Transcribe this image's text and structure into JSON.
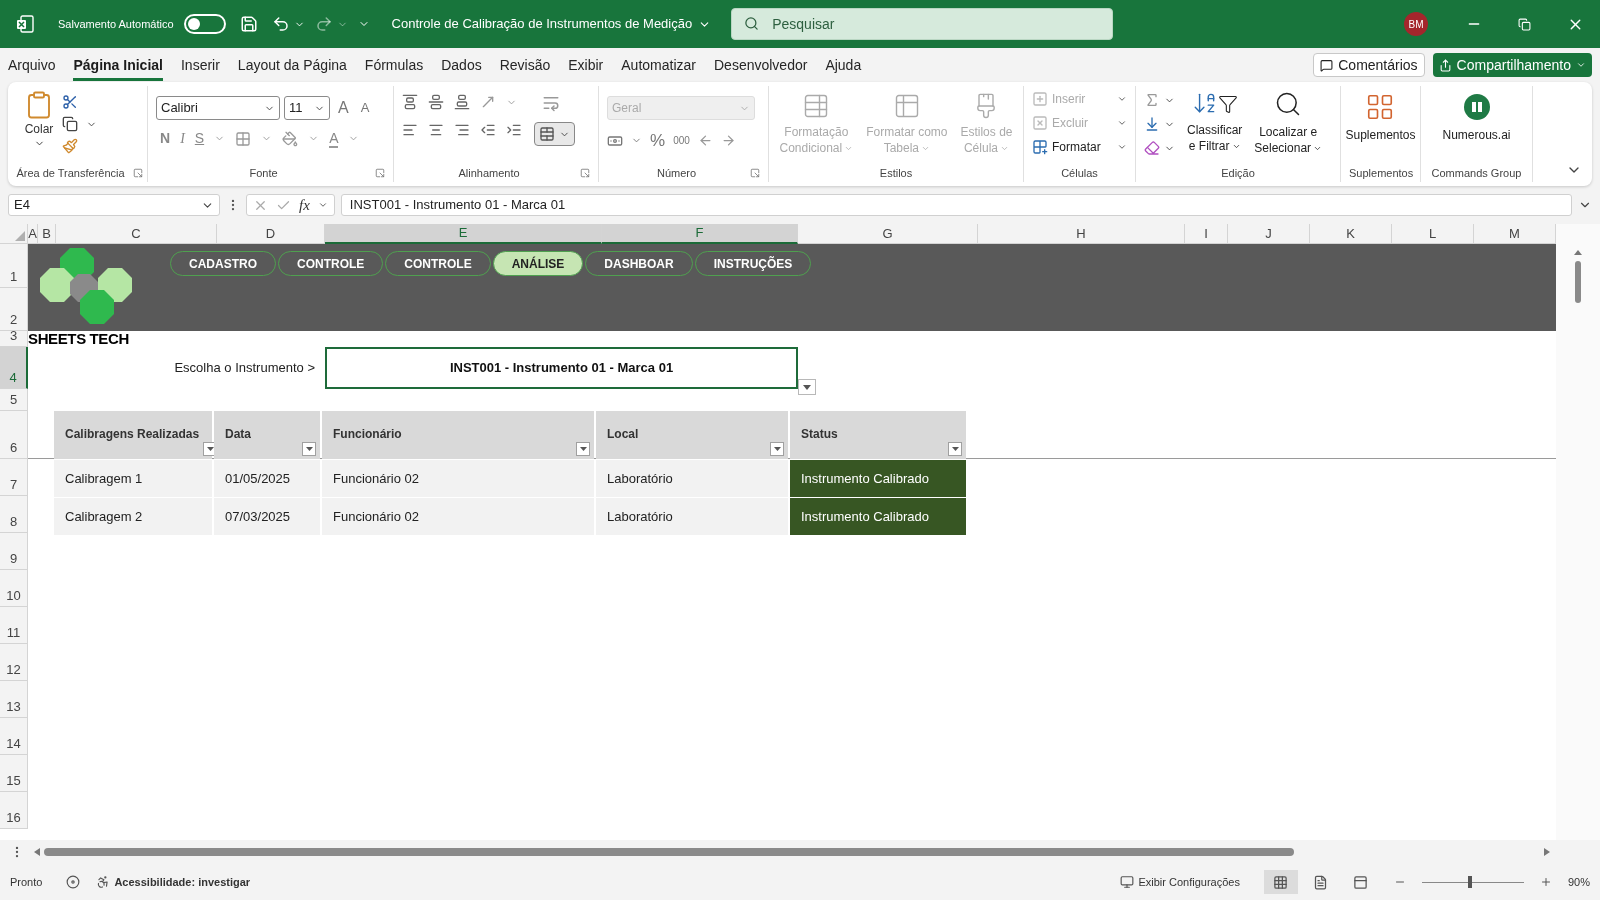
{
  "title_bar": {
    "autosave_label": "Salvamento Automático",
    "autosave_on": false,
    "document_title": "Controle de Calibração de Instrumentos de Medição",
    "search_placeholder": "Pesquisar",
    "user_initials": "BM"
  },
  "menu_tabs": [
    {
      "label": "Arquivo",
      "selected": false
    },
    {
      "label": "Página Inicial",
      "selected": true
    },
    {
      "label": "Inserir",
      "selected": false
    },
    {
      "label": "Layout da Página",
      "selected": false
    },
    {
      "label": "Fórmulas",
      "selected": false
    },
    {
      "label": "Dados",
      "selected": false
    },
    {
      "label": "Revisão",
      "selected": false
    },
    {
      "label": "Exibir",
      "selected": false
    },
    {
      "label": "Automatizar",
      "selected": false
    },
    {
      "label": "Desenvolvedor",
      "selected": false
    },
    {
      "label": "Ajuda",
      "selected": false
    }
  ],
  "comments_button": "Comentários",
  "share_button": "Compartilhamento",
  "ribbon": [
    {
      "kind": "clipboard",
      "label": "Área de Transferência",
      "paste": "Colar"
    },
    {
      "kind": "font",
      "label": "Fonte",
      "font_name": "Calibri",
      "font_size": "11",
      "grow": "A",
      "shrink": "A",
      "bold": "N",
      "italic": "I",
      "underline": "S",
      "font_color": "A"
    },
    {
      "kind": "alignment",
      "label": "Alinhamento"
    },
    {
      "kind": "number",
      "label": "Número",
      "format": "Geral",
      "percent": "%",
      "thousands": "000"
    },
    {
      "kind": "styles",
      "label": "Estilos",
      "buttons": [
        {
          "lines": [
            "Formatação",
            "Condicional"
          ],
          "disabled": true
        },
        {
          "lines": [
            "Formatar como",
            "Tabela"
          ],
          "disabled": true
        },
        {
          "lines": [
            "Estilos de",
            "Célula"
          ],
          "disabled": true
        }
      ]
    },
    {
      "kind": "cells",
      "label": "Células",
      "buttons": [
        {
          "label": "Inserir",
          "disabled": true
        },
        {
          "label": "Excluir",
          "disabled": true
        },
        {
          "label": "Formatar",
          "disabled": false
        }
      ]
    },
    {
      "kind": "editing",
      "label": "Edição",
      "buttons": [
        {
          "lines": [
            "Classificar",
            "e Filtrar"
          ]
        },
        {
          "lines": [
            "Localizar e",
            "Selecionar"
          ]
        }
      ]
    },
    {
      "kind": "addins",
      "label": "Suplementos",
      "button": "Suplementos"
    },
    {
      "kind": "commands",
      "label": "Commands Group",
      "button": "Numerous.ai"
    }
  ],
  "formula_bar": {
    "name_box": "E4",
    "fx": "fx",
    "formula": "INST001 - Instrumento 01 - Marca 01"
  },
  "columns": [
    {
      "label": "A",
      "selected": false
    },
    {
      "label": "B",
      "selected": false
    },
    {
      "label": "C",
      "selected": false
    },
    {
      "label": "D",
      "selected": false
    },
    {
      "label": "E",
      "selected": true
    },
    {
      "label": "F",
      "selected": true
    },
    {
      "label": "G",
      "selected": false
    },
    {
      "label": "H",
      "selected": false
    },
    {
      "label": "I",
      "selected": false
    },
    {
      "label": "J",
      "selected": false
    },
    {
      "label": "K",
      "selected": false
    },
    {
      "label": "L",
      "selected": false
    },
    {
      "label": "M",
      "selected": false
    }
  ],
  "rows": [
    {
      "label": "1",
      "selected": false
    },
    {
      "label": "2",
      "selected": false
    },
    {
      "label": "3",
      "selected": false
    },
    {
      "label": "4",
      "selected": true
    },
    {
      "label": "5",
      "selected": false
    },
    {
      "label": "6",
      "selected": false
    },
    {
      "label": "7",
      "selected": false
    },
    {
      "label": "8",
      "selected": false
    },
    {
      "label": "9",
      "selected": false
    },
    {
      "label": "10",
      "selected": false
    },
    {
      "label": "11",
      "selected": false
    },
    {
      "label": "12",
      "selected": false
    },
    {
      "label": "13",
      "selected": false
    },
    {
      "label": "14",
      "selected": false
    },
    {
      "label": "15",
      "selected": false
    },
    {
      "label": "16",
      "selected": false
    }
  ],
  "banner": {
    "logo_text": "SHEETS TECH",
    "nav": [
      {
        "label": "CADASTRO",
        "selected": false
      },
      {
        "label": "CONTROLE",
        "selected": false
      },
      {
        "label": "CONTROLE",
        "selected": false
      },
      {
        "label": "ANÁLISE",
        "selected": true
      },
      {
        "label": "DASHBOAR",
        "selected": false
      },
      {
        "label": "INSTRUÇÕES",
        "selected": false
      }
    ]
  },
  "picker": {
    "label": "Escolha o Instrumento >",
    "value": "INST001 - Instrumento 01 - Marca 01"
  },
  "table": {
    "columns": [
      {
        "label": "Calibragens Realizadas",
        "kind": "text"
      },
      {
        "label": "Data",
        "kind": "text"
      },
      {
        "label": "Funcionário",
        "kind": "text"
      },
      {
        "label": "Local",
        "kind": "text"
      },
      {
        "label": "Status",
        "kind": "status"
      }
    ],
    "rows": [
      [
        "Calibragem 1",
        "01/05/2025",
        "Funcionário 02",
        "Laboratório",
        "Instrumento Calibrado"
      ],
      [
        "Calibragem 2",
        "07/03/2025",
        "Funcionário 02",
        "Laboratório",
        "Instrumento Calibrado"
      ]
    ]
  },
  "status_bar": {
    "ready": "Pronto",
    "accessibility": "Acessibilidade: investigar",
    "display_settings": "Exibir Configurações",
    "views": [
      {
        "selected": true
      },
      {
        "selected": false
      },
      {
        "selected": false
      }
    ],
    "zoom_slider": {
      "level": 0.47
    },
    "zoom": "90%"
  }
}
